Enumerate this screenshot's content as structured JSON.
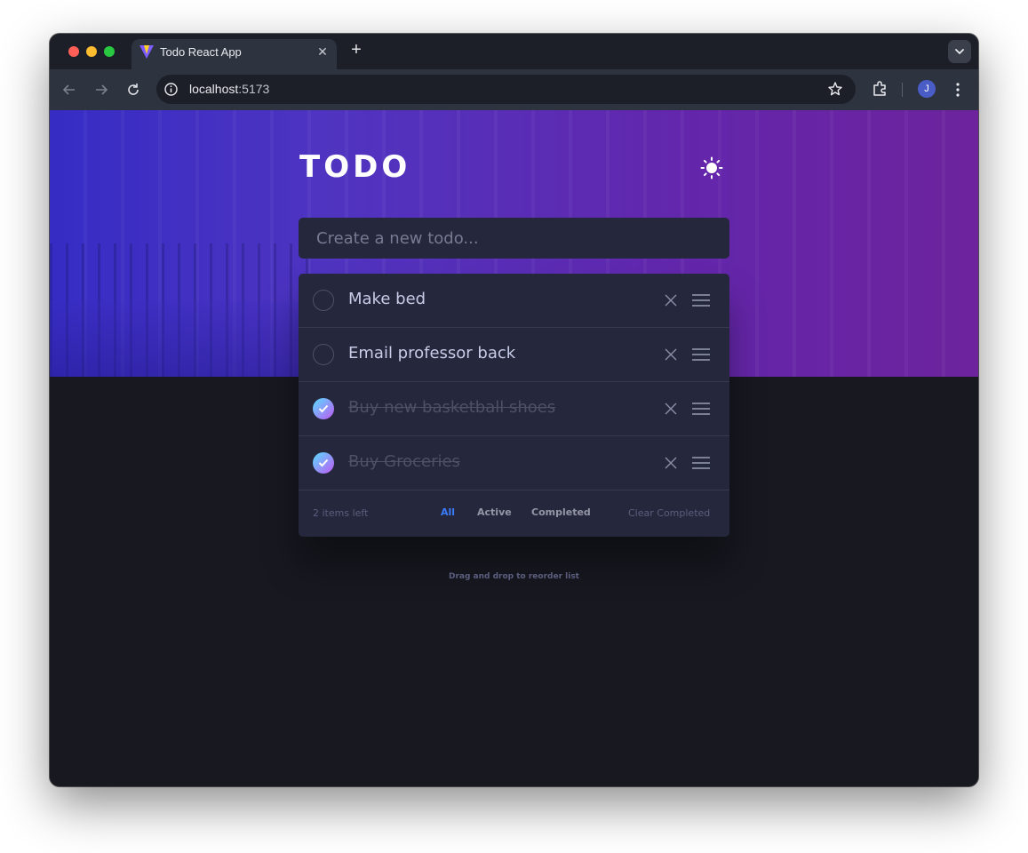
{
  "browser": {
    "tab_title": "Todo React App",
    "tab_close_glyph": "✕",
    "new_tab_glyph": "+",
    "url_host": "localhost",
    "url_port": ":5173",
    "avatar_initial": "J",
    "icons": [
      "back-icon",
      "forward-icon",
      "reload-icon",
      "info-icon",
      "star-icon",
      "extensions-icon",
      "kebab-menu-icon",
      "vite-favicon-icon"
    ]
  },
  "app": {
    "title": "TODO",
    "theme_icon": "sun-icon",
    "input_placeholder": "Create a new todo...",
    "todos": [
      {
        "text": "Make bed",
        "completed": false
      },
      {
        "text": "Email professor back",
        "completed": false
      },
      {
        "text": "Buy new basketball shoes",
        "completed": true
      },
      {
        "text": "Buy Groceries",
        "completed": true
      }
    ],
    "footer": {
      "items_left": "2 items left",
      "filters": [
        "All",
        "Active",
        "Completed"
      ],
      "selected_filter": "All",
      "clear_label": "Clear Completed"
    },
    "hint": "Drag and drop to reorder list"
  },
  "colors": {
    "accent": "#3a7cfd",
    "card": "#25273c",
    "background": "#171820",
    "check_gradient_start": "#57ddff",
    "check_gradient_end": "#c058f3"
  }
}
